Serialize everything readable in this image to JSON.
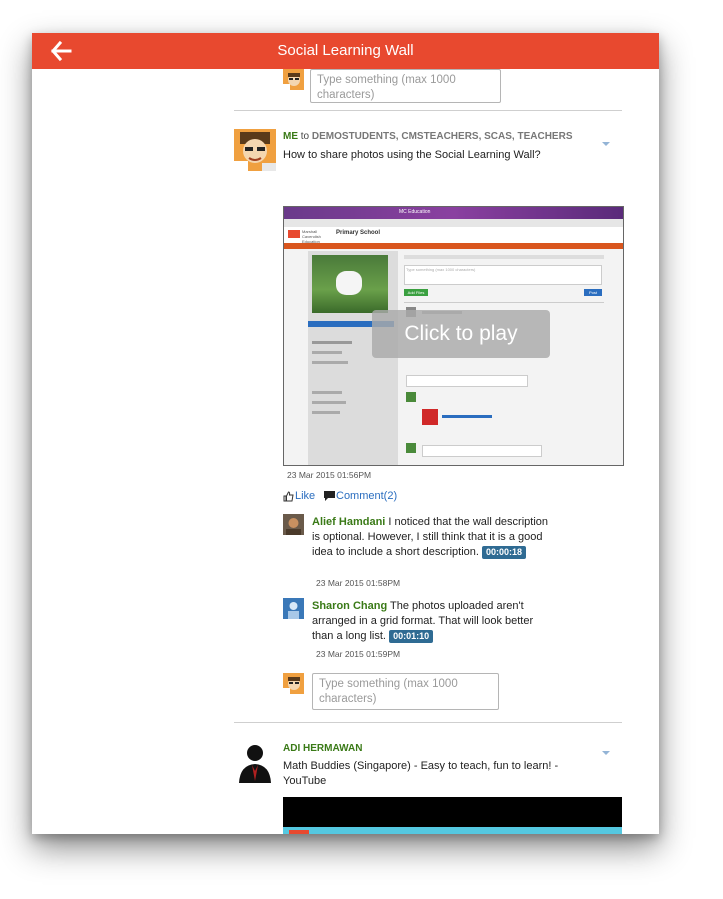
{
  "header": {
    "title": "Social Learning Wall",
    "back_icon": "arrow-left-icon"
  },
  "composer_top": {
    "placeholder": "Type something (max 1000 characters)"
  },
  "post1": {
    "author": "ME",
    "to_word": "to",
    "audience": "DEMOSTUDENTS, CMSTEACHERS, SCAS, TEACHERS",
    "text": "How to share photos using the Social Learning Wall?",
    "overlay_label": "Click to play",
    "timestamp": "23 Mar 2015 01:56PM",
    "like_label": "Like",
    "comment_label": "Comment(2)",
    "screenshot": {
      "browser_title": "MC Education",
      "school_name": "Primary School",
      "brand": "Marshall Cavendish Education",
      "post_placeholder": "Type something (max 1000 characters)",
      "add_files": "Add Files",
      "post_button": "Post"
    }
  },
  "comments": [
    {
      "author": "Alief Hamdani",
      "text": "I noticed that the wall description is optional. However, I still think that it is a good idea to include a short description.",
      "duration": "00:00:18",
      "timestamp": "23 Mar 2015 01:58PM"
    },
    {
      "author": "Sharon Chang",
      "text": "The photos uploaded aren't arranged in a grid format. That will look better than a long list.",
      "duration": "00:01:10",
      "timestamp": "23 Mar 2015 01:59PM"
    }
  ],
  "composer_comment": {
    "placeholder": "Type something (max 1000 characters)"
  },
  "post2": {
    "author": "ADI HERMAWAN",
    "text": "Math Buddies (Singapore) - Easy to teach, fun to learn! - YouTube"
  },
  "colors": {
    "header_bg": "#e8492f",
    "author_green": "#3a7a17",
    "link_blue": "#2a6dbf",
    "badge_blue": "#2f6b93"
  }
}
